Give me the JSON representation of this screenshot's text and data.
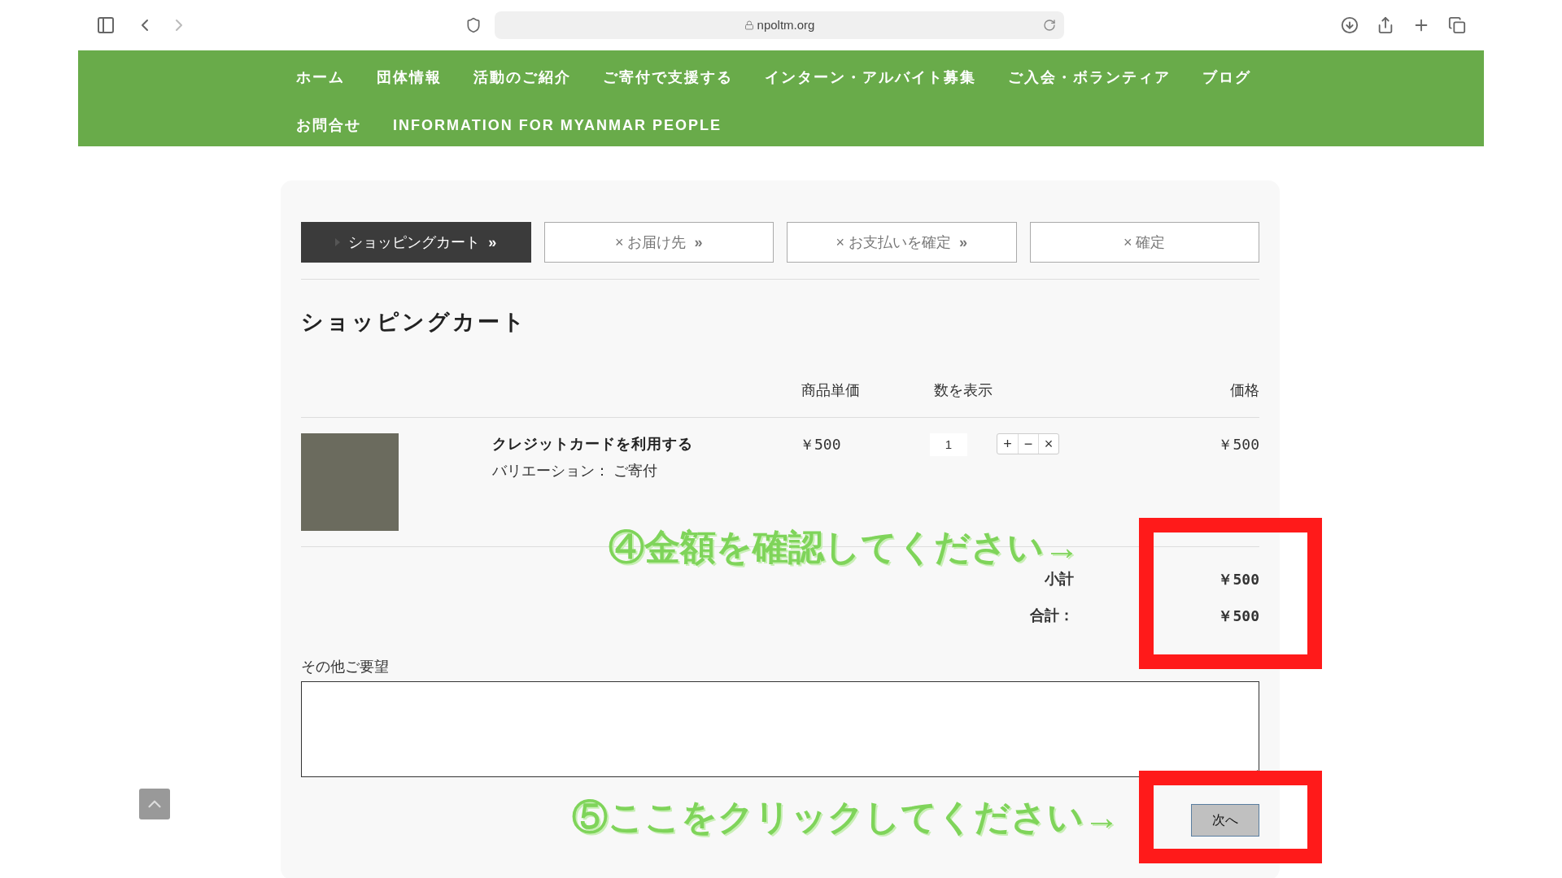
{
  "browser": {
    "url": "npoltm.org"
  },
  "nav": {
    "items": [
      {
        "label": "ホーム"
      },
      {
        "label": "団体情報"
      },
      {
        "label": "活動のご紹介"
      },
      {
        "label": "ご寄付で支援する"
      },
      {
        "label": "インターン・アルバイト募集"
      },
      {
        "label": "ご入会・ボランティア"
      },
      {
        "label": "ブログ"
      },
      {
        "label": "お問合せ"
      },
      {
        "label": "INFORMATION FOR MYANMAR PEOPLE"
      }
    ]
  },
  "steps": [
    {
      "label": "ショッピングカート",
      "suffix": "»",
      "selected": true
    },
    {
      "label": "× お届け先",
      "suffix": "»",
      "selected": false
    },
    {
      "label": "× お支払いを確定",
      "suffix": "»",
      "selected": false
    },
    {
      "label": "× 確定",
      "selected": false
    }
  ],
  "cart": {
    "title": "ショッピングカート",
    "columns": [
      "商品単価",
      "数を表示",
      "価格"
    ],
    "rows": [
      {
        "name": "クレジットカードを利用する",
        "variation": "バリエーション： ご寄付",
        "unit_price": "￥500",
        "quantity": "1",
        "controls": [
          "+",
          "−",
          "×"
        ],
        "price": "￥500"
      }
    ],
    "subtotal": {
      "label": "小計",
      "value": "￥500"
    },
    "total": {
      "label": "合計：",
      "value": "￥500"
    }
  },
  "notes": {
    "label": "その他ご要望"
  },
  "next_button": "次へ",
  "annotations": [
    "④金額を確認してください→",
    "⑤ここをクリックしてください→"
  ]
}
